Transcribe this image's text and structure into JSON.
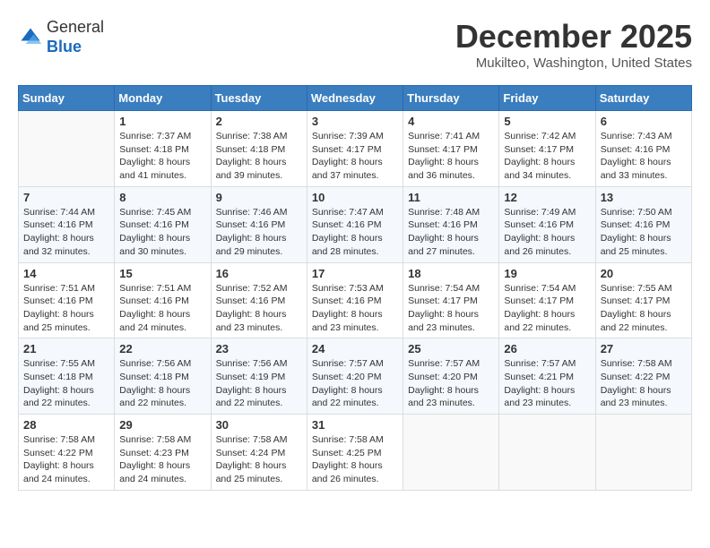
{
  "header": {
    "logo_line1": "General",
    "logo_line2": "Blue",
    "month_title": "December 2025",
    "location": "Mukilteo, Washington, United States"
  },
  "weekdays": [
    "Sunday",
    "Monday",
    "Tuesday",
    "Wednesday",
    "Thursday",
    "Friday",
    "Saturday"
  ],
  "weeks": [
    [
      {
        "day": "",
        "sunrise": "",
        "sunset": "",
        "daylight": ""
      },
      {
        "day": "1",
        "sunrise": "Sunrise: 7:37 AM",
        "sunset": "Sunset: 4:18 PM",
        "daylight": "Daylight: 8 hours and 41 minutes."
      },
      {
        "day": "2",
        "sunrise": "Sunrise: 7:38 AM",
        "sunset": "Sunset: 4:18 PM",
        "daylight": "Daylight: 8 hours and 39 minutes."
      },
      {
        "day": "3",
        "sunrise": "Sunrise: 7:39 AM",
        "sunset": "Sunset: 4:17 PM",
        "daylight": "Daylight: 8 hours and 37 minutes."
      },
      {
        "day": "4",
        "sunrise": "Sunrise: 7:41 AM",
        "sunset": "Sunset: 4:17 PM",
        "daylight": "Daylight: 8 hours and 36 minutes."
      },
      {
        "day": "5",
        "sunrise": "Sunrise: 7:42 AM",
        "sunset": "Sunset: 4:17 PM",
        "daylight": "Daylight: 8 hours and 34 minutes."
      },
      {
        "day": "6",
        "sunrise": "Sunrise: 7:43 AM",
        "sunset": "Sunset: 4:16 PM",
        "daylight": "Daylight: 8 hours and 33 minutes."
      }
    ],
    [
      {
        "day": "7",
        "sunrise": "Sunrise: 7:44 AM",
        "sunset": "Sunset: 4:16 PM",
        "daylight": "Daylight: 8 hours and 32 minutes."
      },
      {
        "day": "8",
        "sunrise": "Sunrise: 7:45 AM",
        "sunset": "Sunset: 4:16 PM",
        "daylight": "Daylight: 8 hours and 30 minutes."
      },
      {
        "day": "9",
        "sunrise": "Sunrise: 7:46 AM",
        "sunset": "Sunset: 4:16 PM",
        "daylight": "Daylight: 8 hours and 29 minutes."
      },
      {
        "day": "10",
        "sunrise": "Sunrise: 7:47 AM",
        "sunset": "Sunset: 4:16 PM",
        "daylight": "Daylight: 8 hours and 28 minutes."
      },
      {
        "day": "11",
        "sunrise": "Sunrise: 7:48 AM",
        "sunset": "Sunset: 4:16 PM",
        "daylight": "Daylight: 8 hours and 27 minutes."
      },
      {
        "day": "12",
        "sunrise": "Sunrise: 7:49 AM",
        "sunset": "Sunset: 4:16 PM",
        "daylight": "Daylight: 8 hours and 26 minutes."
      },
      {
        "day": "13",
        "sunrise": "Sunrise: 7:50 AM",
        "sunset": "Sunset: 4:16 PM",
        "daylight": "Daylight: 8 hours and 25 minutes."
      }
    ],
    [
      {
        "day": "14",
        "sunrise": "Sunrise: 7:51 AM",
        "sunset": "Sunset: 4:16 PM",
        "daylight": "Daylight: 8 hours and 25 minutes."
      },
      {
        "day": "15",
        "sunrise": "Sunrise: 7:51 AM",
        "sunset": "Sunset: 4:16 PM",
        "daylight": "Daylight: 8 hours and 24 minutes."
      },
      {
        "day": "16",
        "sunrise": "Sunrise: 7:52 AM",
        "sunset": "Sunset: 4:16 PM",
        "daylight": "Daylight: 8 hours and 23 minutes."
      },
      {
        "day": "17",
        "sunrise": "Sunrise: 7:53 AM",
        "sunset": "Sunset: 4:16 PM",
        "daylight": "Daylight: 8 hours and 23 minutes."
      },
      {
        "day": "18",
        "sunrise": "Sunrise: 7:54 AM",
        "sunset": "Sunset: 4:17 PM",
        "daylight": "Daylight: 8 hours and 23 minutes."
      },
      {
        "day": "19",
        "sunrise": "Sunrise: 7:54 AM",
        "sunset": "Sunset: 4:17 PM",
        "daylight": "Daylight: 8 hours and 22 minutes."
      },
      {
        "day": "20",
        "sunrise": "Sunrise: 7:55 AM",
        "sunset": "Sunset: 4:17 PM",
        "daylight": "Daylight: 8 hours and 22 minutes."
      }
    ],
    [
      {
        "day": "21",
        "sunrise": "Sunrise: 7:55 AM",
        "sunset": "Sunset: 4:18 PM",
        "daylight": "Daylight: 8 hours and 22 minutes."
      },
      {
        "day": "22",
        "sunrise": "Sunrise: 7:56 AM",
        "sunset": "Sunset: 4:18 PM",
        "daylight": "Daylight: 8 hours and 22 minutes."
      },
      {
        "day": "23",
        "sunrise": "Sunrise: 7:56 AM",
        "sunset": "Sunset: 4:19 PM",
        "daylight": "Daylight: 8 hours and 22 minutes."
      },
      {
        "day": "24",
        "sunrise": "Sunrise: 7:57 AM",
        "sunset": "Sunset: 4:20 PM",
        "daylight": "Daylight: 8 hours and 22 minutes."
      },
      {
        "day": "25",
        "sunrise": "Sunrise: 7:57 AM",
        "sunset": "Sunset: 4:20 PM",
        "daylight": "Daylight: 8 hours and 23 minutes."
      },
      {
        "day": "26",
        "sunrise": "Sunrise: 7:57 AM",
        "sunset": "Sunset: 4:21 PM",
        "daylight": "Daylight: 8 hours and 23 minutes."
      },
      {
        "day": "27",
        "sunrise": "Sunrise: 7:58 AM",
        "sunset": "Sunset: 4:22 PM",
        "daylight": "Daylight: 8 hours and 23 minutes."
      }
    ],
    [
      {
        "day": "28",
        "sunrise": "Sunrise: 7:58 AM",
        "sunset": "Sunset: 4:22 PM",
        "daylight": "Daylight: 8 hours and 24 minutes."
      },
      {
        "day": "29",
        "sunrise": "Sunrise: 7:58 AM",
        "sunset": "Sunset: 4:23 PM",
        "daylight": "Daylight: 8 hours and 24 minutes."
      },
      {
        "day": "30",
        "sunrise": "Sunrise: 7:58 AM",
        "sunset": "Sunset: 4:24 PM",
        "daylight": "Daylight: 8 hours and 25 minutes."
      },
      {
        "day": "31",
        "sunrise": "Sunrise: 7:58 AM",
        "sunset": "Sunset: 4:25 PM",
        "daylight": "Daylight: 8 hours and 26 minutes."
      },
      {
        "day": "",
        "sunrise": "",
        "sunset": "",
        "daylight": ""
      },
      {
        "day": "",
        "sunrise": "",
        "sunset": "",
        "daylight": ""
      },
      {
        "day": "",
        "sunrise": "",
        "sunset": "",
        "daylight": ""
      }
    ]
  ]
}
